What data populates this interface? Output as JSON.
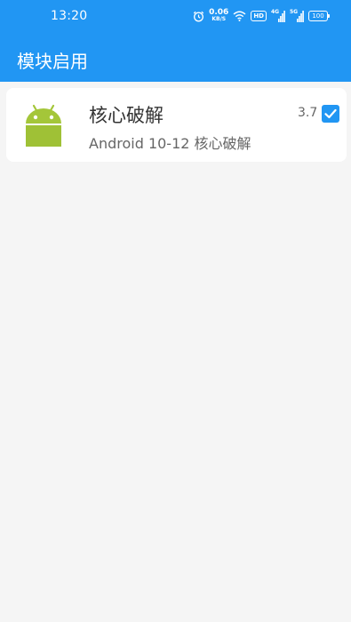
{
  "status_bar": {
    "time": "13:20",
    "net_speed_value": "0.06",
    "net_speed_unit": "KB/S",
    "hd_label": "HD",
    "sim1_label": "4G",
    "sim2_label": "5G",
    "battery_level": "100"
  },
  "app_bar": {
    "title": "模块启用"
  },
  "modules": [
    {
      "name": "核心破解",
      "description": "Android 10-12 核心破解",
      "version": "3.7",
      "enabled": true,
      "icon": "android-icon"
    }
  ],
  "colors": {
    "primary": "#2196f3",
    "android_green": "#a4c639",
    "background": "#f5f5f5"
  }
}
